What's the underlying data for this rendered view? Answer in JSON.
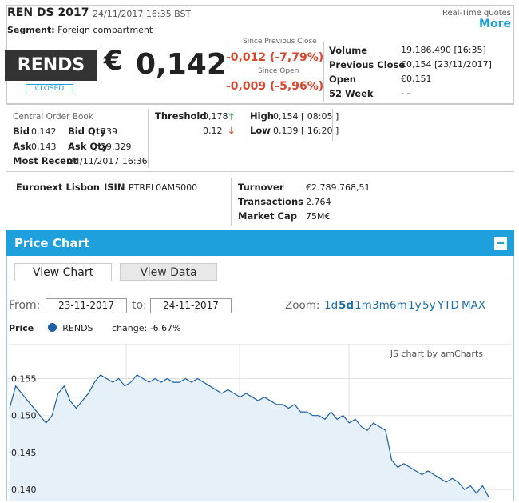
{
  "header": {
    "title": "REN DS 2017",
    "datetime": "24/11/2017 16:35 BST",
    "segment_label": "Segment:",
    "segment_value": "Foreign compartment",
    "realtime_label": "Real-Time quotes",
    "more_label": "More",
    "ticker": "RENDS",
    "status": "CLOSED",
    "currency": "€",
    "price": "0,142",
    "since_prev_label": "Since Previous Close",
    "since_prev_change": "-0,012 (-7,79%)",
    "since_open_label": "Since Open",
    "since_open_change": "-0,009 (-5,96%)"
  },
  "stats": {
    "volume_label": "Volume",
    "volume": "19.186.490 [16:35]",
    "prev_close_label": "Previous Close",
    "prev_close": "€0,154 [23/11/2017]",
    "open_label": "Open",
    "open": "€0,151",
    "week52_label": "52 Week",
    "week52": "- -"
  },
  "order_book": {
    "title": "Central Order Book",
    "bid_label": "Bid",
    "bid": "0,142",
    "bid_qty_label": "Bid Qty",
    "bid_qty": "339",
    "ask_label": "Ask",
    "ask": "0,143",
    "ask_qty_label": "Ask Qty",
    "ask_qty": "29.329",
    "most_recent_label": "Most Recent",
    "most_recent": "24/11/2017 16:36"
  },
  "threshold": {
    "label": "Threshold",
    "upper": "0,178",
    "lower": "0,12",
    "high_label": "High",
    "high": "0,154 [ 08:05 ]",
    "low_label": "Low",
    "low": "0,139 [ 16:20 ]"
  },
  "info": {
    "market": "Euronext Lisbon",
    "isin_label": "ISIN",
    "isin": "PTREL0AMS000",
    "turnover_label": "Turnover",
    "turnover": "€2.789.768,51",
    "transactions_label": "Transactions",
    "transactions": "2.764",
    "market_cap_label": "Market Cap",
    "market_cap": "75M€"
  },
  "panel": {
    "title": "Price Chart",
    "tabs": [
      "View Chart",
      "View Data"
    ],
    "from_label": "From:",
    "from_date": "23-11-2017",
    "to_label": "to:",
    "to_date": "24-11-2017",
    "zoom_label": "Zoom:",
    "zoom_options": [
      "1d",
      "5d",
      "1m",
      "3m",
      "6m",
      "1y",
      "5y",
      "YTD",
      "MAX"
    ],
    "legend_label": "Price",
    "series_name": "RENDS",
    "change_text": "change: -6.67%",
    "credit": "JS chart by amCharts",
    "colors": {
      "accent": "#1ea0dc",
      "line": "#1a5fa8",
      "fill": "#e6f0f8",
      "down": "#d9442c",
      "up": "#2a9d4a"
    }
  },
  "chart_data": {
    "type": "area",
    "yticks": [
      "0.155",
      "0.150",
      "0.145",
      "0.140"
    ],
    "ylim": [
      0.1385,
      0.157
    ],
    "series": [
      {
        "name": "RENDS",
        "values": [
          0.151,
          0.154,
          0.153,
          0.152,
          0.151,
          0.15,
          0.149,
          0.15,
          0.153,
          0.154,
          0.152,
          0.151,
          0.152,
          0.153,
          0.1545,
          0.1555,
          0.155,
          0.1545,
          0.155,
          0.154,
          0.1545,
          0.1555,
          0.155,
          0.1545,
          0.155,
          0.1545,
          0.155,
          0.1545,
          0.1545,
          0.155,
          0.1545,
          0.155,
          0.1545,
          0.154,
          0.1535,
          0.153,
          0.1535,
          0.153,
          0.1525,
          0.153,
          0.1525,
          0.152,
          0.1525,
          0.152,
          0.1515,
          0.1515,
          0.151,
          0.1515,
          0.1505,
          0.1505,
          0.15,
          0.15,
          0.1495,
          0.1505,
          0.1495,
          0.15,
          0.149,
          0.1495,
          0.1485,
          0.148,
          0.149,
          0.1485,
          0.148,
          0.144,
          0.143,
          0.1435,
          0.143,
          0.1425,
          0.142,
          0.1425,
          0.142,
          0.1415,
          0.141,
          0.1415,
          0.141,
          0.14,
          0.1405,
          0.1395,
          0.1405,
          0.139
        ]
      }
    ]
  }
}
